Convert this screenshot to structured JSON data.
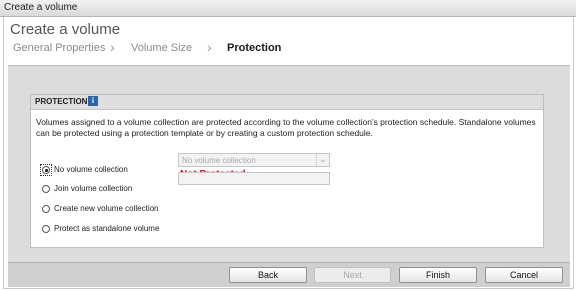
{
  "window": {
    "title": "Create a volume"
  },
  "wizard": {
    "heading": "Create a volume",
    "steps": [
      {
        "label": "General Properties"
      },
      {
        "label": "Volume Size"
      },
      {
        "label": "Protection"
      }
    ],
    "separator": "›"
  },
  "protection": {
    "title": "PROTECTION",
    "info_icon": "i",
    "description": "Volumes assigned to a volume collection are protected according to the volume collection's protection schedule. Standalone volumes can be protected using a protection template or by creating a custom protection schedule.",
    "status": "Not Protected",
    "status_color": "#e0001a",
    "options": [
      {
        "label": "No volume collection",
        "selected": true
      },
      {
        "label": "Join volume collection",
        "selected": false
      },
      {
        "label": "Create new volume collection",
        "selected": false
      },
      {
        "label": "Protect as standalone volume",
        "selected": false
      }
    ],
    "collection_select": {
      "value": "No volume collection"
    },
    "new_collection_input": {
      "value": ""
    }
  },
  "footer": {
    "back": "Back",
    "next": "Next",
    "finish": "Finish",
    "cancel": "Cancel"
  }
}
